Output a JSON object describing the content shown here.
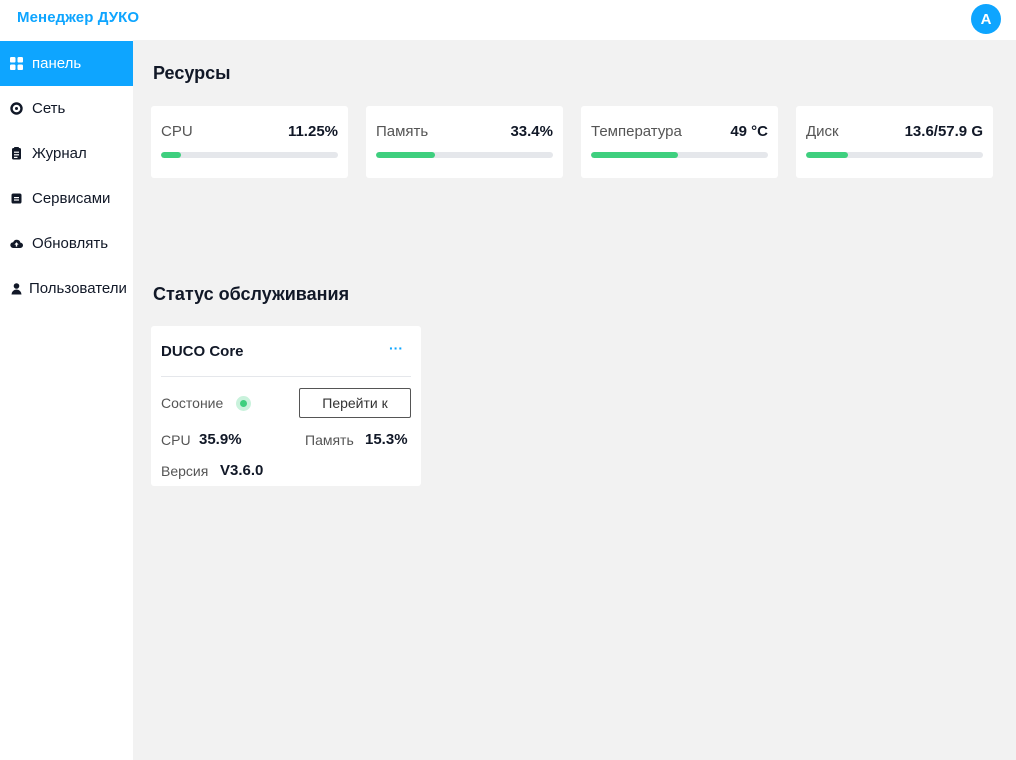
{
  "app": {
    "title": "Менеджер ДУКО",
    "avatar_letter": "A"
  },
  "sidebar": {
    "items": [
      {
        "label": "панель",
        "icon": "dashboard-icon",
        "active": true
      },
      {
        "label": "Сеть",
        "icon": "network-icon",
        "active": false
      },
      {
        "label": "Журнал",
        "icon": "journal-icon",
        "active": false
      },
      {
        "label": "Сервисами",
        "icon": "services-icon",
        "active": false
      },
      {
        "label": "Обновлять",
        "icon": "cloud-update-icon",
        "active": false
      },
      {
        "label": "Пользователи",
        "icon": "user-icon",
        "active": false
      }
    ]
  },
  "resources": {
    "title": "Ресурсы",
    "cards": [
      {
        "label": "CPU",
        "value": "11.25%",
        "fill_fraction": 0.1125
      },
      {
        "label": "Память",
        "value": "33.4%",
        "fill_fraction": 0.334
      },
      {
        "label": "Температура",
        "value": "49 °C",
        "fill_fraction": 0.49
      },
      {
        "label": "Диск",
        "value": "13.6/57.9 G",
        "fill_fraction": 0.235
      }
    ]
  },
  "service_status": {
    "title": "Статус обслуживания",
    "service": {
      "name": "DUCO Core",
      "more_label": "···",
      "status_label": "Состоние",
      "status": "running",
      "goto_label": "Перейти к",
      "cpu_label": "CPU",
      "cpu_value": "35.9%",
      "memory_label": "Память",
      "memory_value": "15.3%",
      "version_label": "Версия",
      "version_value": "V3.6.0"
    }
  },
  "colors": {
    "accent": "#0ea5ff",
    "progress": "#3ecf7e",
    "track": "#e5e7eb",
    "status_ok": "#3ecf7e"
  }
}
